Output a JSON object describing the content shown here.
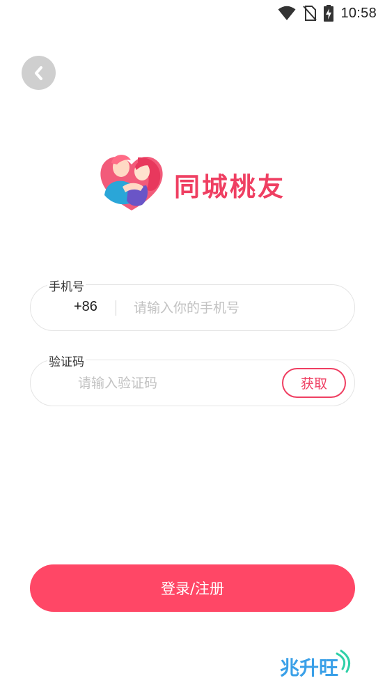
{
  "status_bar": {
    "time": "10:58",
    "icons": [
      "wifi-icon",
      "no-sim-icon",
      "battery-charging-icon"
    ]
  },
  "header": {
    "back_icon": "chevron-left-icon"
  },
  "logo": {
    "app_name": "同城桃友",
    "brand_color": "#ef3f62"
  },
  "form": {
    "phone": {
      "label": "手机号",
      "country_code": "+86",
      "placeholder": "请输入你的手机号",
      "value": ""
    },
    "code": {
      "label": "验证码",
      "placeholder": "请输入验证码",
      "value": "",
      "get_code_label": "获取"
    }
  },
  "submit": {
    "label": "登录/注册",
    "color": "#ff4766"
  },
  "watermark": {
    "text": "兆升旺"
  }
}
